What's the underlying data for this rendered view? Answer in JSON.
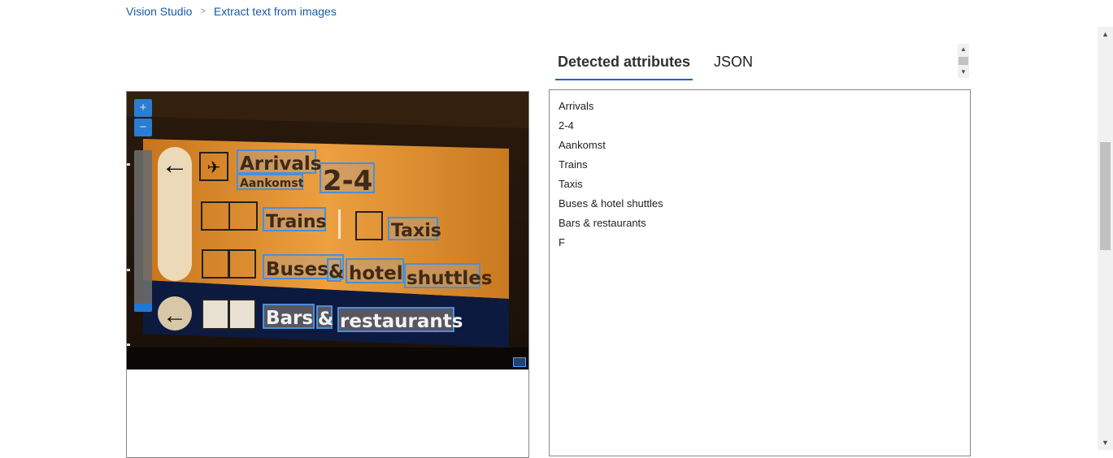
{
  "breadcrumb": {
    "items": [
      "Vision Studio",
      "Extract text from images"
    ],
    "separator": ">"
  },
  "image_viewer": {
    "zoom_in_label": "+",
    "zoom_out_label": "−",
    "sign_text": {
      "arrivals": "Arrivals",
      "aankomst": "Aankomst",
      "gates": "2-4",
      "trains": "Trains",
      "taxis": "Taxis",
      "buses": "Buses",
      "amp1": "&",
      "hotel": "hotel",
      "shuttles": "shuttles",
      "bars": "Bars",
      "amp2": "&",
      "restaurants": "restaurants"
    },
    "colors": {
      "sign_orange": "#e3952f",
      "sign_navy": "#0c1a3f",
      "highlight": "#4a8fd8"
    }
  },
  "tabs": [
    {
      "label": "Detected attributes",
      "active": true
    },
    {
      "label": "JSON",
      "active": false
    }
  ],
  "results": {
    "lines": [
      "Arrivals",
      "2-4",
      "Aankomst",
      "Trains",
      "Taxis",
      "Buses & hotel shuttles",
      "Bars & restaurants",
      "F"
    ]
  }
}
